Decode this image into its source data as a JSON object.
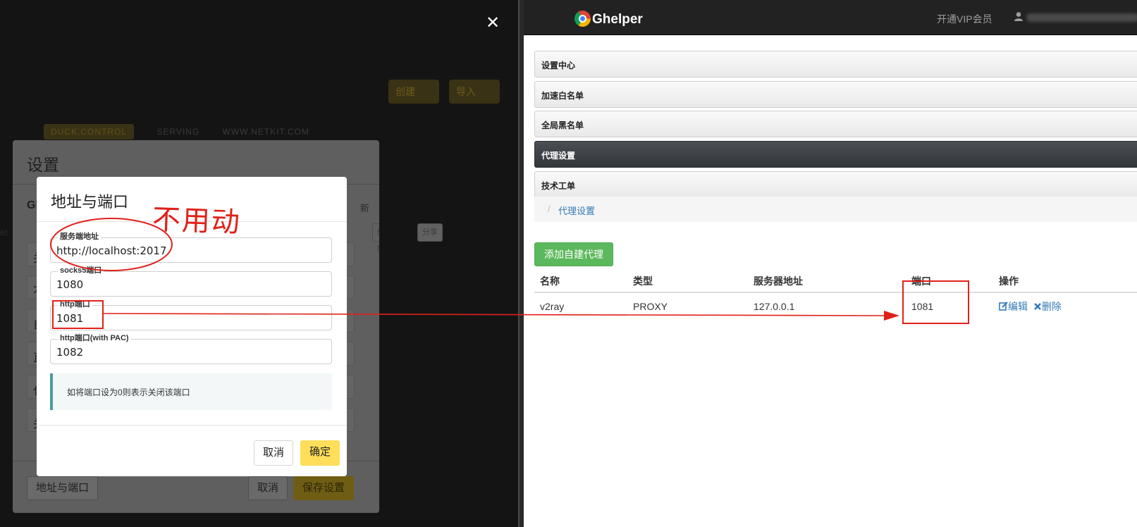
{
  "background_dialog": {
    "title": "设置",
    "header_partial": "Gl",
    "right_partial": "新",
    "edge_partial": "et",
    "mini_btn_1": "删除",
    "mini_btn_2": "分享",
    "create_label": "创建",
    "import_label": "导入",
    "bg_tabs": [
      "DUCK.CONTROL",
      "SERVING",
      "WWW.NETKIT.COM"
    ],
    "row_initials": [
      "关",
      "不",
      "自",
      "直",
      "代",
      "关"
    ],
    "footer_address_port": "地址与端口",
    "footer_cancel": "取消",
    "footer_save": "保存设置"
  },
  "port_dialog": {
    "title": "地址与端口",
    "fields": [
      {
        "legend": "服务端地址",
        "value": "http://localhost:2017"
      },
      {
        "legend": "socks5端口",
        "value": "1080"
      },
      {
        "legend": "http端口",
        "value": "1081"
      },
      {
        "legend": "http端口(with PAC)",
        "value": "1082"
      }
    ],
    "note": "如将端口设为0则表示关闭该端口",
    "cancel_label": "取消",
    "confirm_label": "确定"
  },
  "close_icon_glyph": "✕",
  "annotation": {
    "note_text": "不用动",
    "color": "#e0211a"
  },
  "ghelper": {
    "brand": "Ghelper",
    "vip_link": "开通VIP会员",
    "menu": [
      {
        "label": "设置中心",
        "active": false
      },
      {
        "label": "加速白名单",
        "active": false
      },
      {
        "label": "全局黑名单",
        "active": false
      },
      {
        "label": "代理设置",
        "active": true
      },
      {
        "label": "技术工单",
        "active": false
      }
    ],
    "breadcrumb": {
      "separator": "/",
      "current": "代理设置"
    },
    "add_button": "添加自建代理",
    "table": {
      "headers": [
        "名称",
        "类型",
        "服务器地址",
        "端口",
        "操作"
      ],
      "rows": [
        {
          "name": "v2ray",
          "type": "PROXY",
          "server": "127.0.0.1",
          "port": "1081",
          "edit": "编辑",
          "delete": "删除"
        }
      ]
    },
    "colors": {
      "topbar": "#222222",
      "add_button": "#5cb85c",
      "link": "#337ab7",
      "active_menu": "#3a3e43"
    }
  }
}
